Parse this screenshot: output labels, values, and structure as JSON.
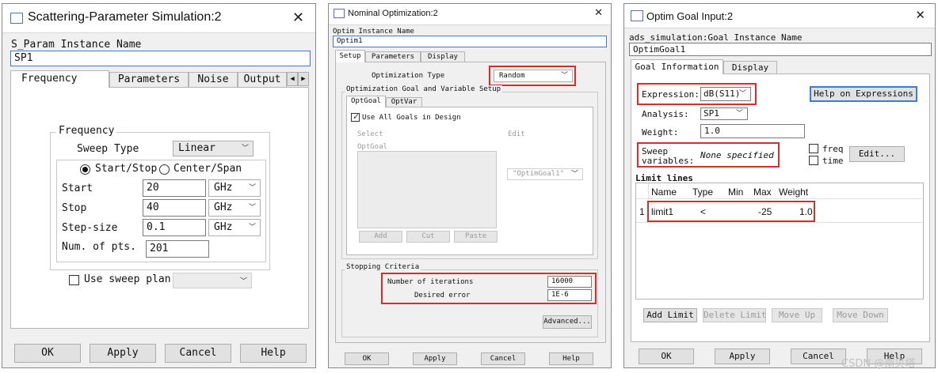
{
  "w1": {
    "title": "Scattering-Parameter Simulation:2",
    "instance_label": "S_Param Instance Name",
    "instance_value": "SP1",
    "tabs": [
      "Frequency",
      "Parameters",
      "Noise",
      "Output"
    ],
    "frequency_group": "Frequency",
    "sweep_type_label": "Sweep Type",
    "sweep_type_value": "Linear",
    "radio_startstop": "Start/Stop",
    "radio_centerspan": "Center/Span",
    "start_label": "Start",
    "start_value": "20",
    "start_unit": "GHz",
    "stop_label": "Stop",
    "stop_value": "40",
    "stop_unit": "GHz",
    "step_label": "Step-size",
    "step_value": "0.1",
    "step_unit": "GHz",
    "numpts_label": "Num. of pts.",
    "numpts_value": "201",
    "sweep_plan_label": "Use sweep plan",
    "buttons": {
      "ok": "OK",
      "apply": "Apply",
      "cancel": "Cancel",
      "help": "Help"
    }
  },
  "w2": {
    "title": "Nominal Optimization:2",
    "instance_label": "Optim Instance Name",
    "instance_value": "Optim1",
    "tabs": [
      "Setup",
      "Parameters",
      "Display"
    ],
    "opt_type_label": "Optimization Type",
    "opt_type_value": "Random",
    "goal_group": "Optimization Goal and Variable Setup",
    "subtabs": [
      "OptGoal",
      "OptVar"
    ],
    "use_all_goals": "Use All Goals in Design",
    "select_label": "Select",
    "edit_label": "Edit",
    "optgoal_label": "OptGoal",
    "edit_combo": "\"OptimGoal1\"",
    "add": "Add",
    "cut": "Cut",
    "paste": "Paste",
    "stop_group": "Stopping Criteria",
    "iterations_label": "Number of iterations",
    "iterations_value": "16000",
    "error_label": "Desired error",
    "error_value": "1E-6",
    "advanced": "Advanced...",
    "buttons": {
      "ok": "OK",
      "apply": "Apply",
      "cancel": "Cancel",
      "help": "Help"
    }
  },
  "w3": {
    "title": "Optim Goal Input:2",
    "instance_label": "ads_simulation:Goal Instance Name",
    "instance_value": "OptimGoal1",
    "tabs": [
      "Goal Information",
      "Display"
    ],
    "expression_label": "Expression:",
    "expression_value": "dB(S11)",
    "help_expr": "Help on Expressions",
    "analysis_label": "Analysis:",
    "analysis_value": "SP1",
    "weight_label": "Weight:",
    "weight_value": "1.0",
    "sweep_label_1": "Sweep",
    "sweep_label_2": "variables:",
    "sweep_value": "None specified",
    "freq": "freq",
    "time": "time",
    "edit": "Edit...",
    "limit_lines": "Limit lines",
    "columns": [
      "Name",
      "Type",
      "Min",
      "Max",
      "Weight"
    ],
    "row": {
      "index": "1",
      "name": "limit1",
      "type": "<",
      "min": "",
      "max": "-25",
      "weight": "1.0"
    },
    "add_limit": "Add Limit",
    "delete_limit": "Delete Limit",
    "move_up": "Move Up",
    "move_down": "Move Down",
    "buttons": {
      "ok": "OK",
      "apply": "Apply",
      "cancel": "Cancel",
      "help": "Help"
    }
  },
  "watermark": "CSDN @南贝塔"
}
